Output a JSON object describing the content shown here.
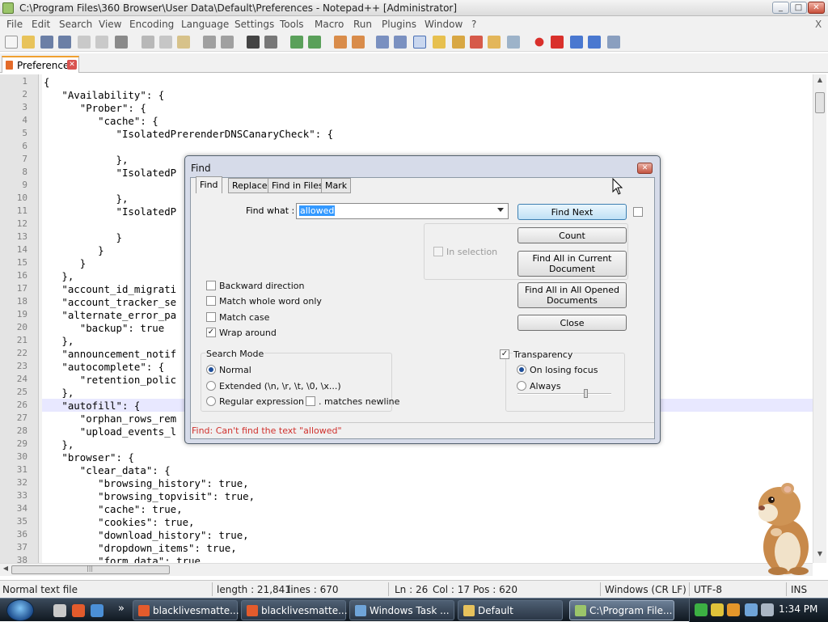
{
  "window": {
    "title": "C:\\Program Files\\360 Browser\\User Data\\Default\\Preferences - Notepad++ [Administrator]",
    "minimize": "_",
    "maximize": "□",
    "close": "✕"
  },
  "menu": {
    "items": [
      "File",
      "Edit",
      "Search",
      "View",
      "Encoding",
      "Language",
      "Settings",
      "Tools",
      "Macro",
      "Run",
      "Plugins",
      "Window",
      "?"
    ],
    "close_x": "X"
  },
  "tab": {
    "label": "Preferences",
    "close": "✕"
  },
  "editor": {
    "line_numbers": [
      "1",
      "2",
      "3",
      "4",
      "5",
      "6",
      "7",
      "8",
      "9",
      "10",
      "11",
      "12",
      "13",
      "14",
      "15",
      "16",
      "17",
      "18",
      "19",
      "20",
      "21",
      "22",
      "23",
      "24",
      "25",
      "26",
      "27",
      "28",
      "29",
      "30",
      "31",
      "32",
      "33",
      "34",
      "35",
      "36",
      "37",
      "38"
    ],
    "lines": [
      "{",
      "   \"Availability\": {",
      "      \"Prober\": {",
      "         \"cache\": {",
      "            \"IsolatedPrerenderDNSCanaryCheck\": {",
      "",
      "            },",
      "            \"IsolatedP",
      "",
      "            },",
      "            \"IsolatedP",
      "",
      "            }",
      "         }",
      "      }",
      "   },",
      "   \"account_id_migrati",
      "   \"account_tracker_se",
      "   \"alternate_error_pa",
      "      \"backup\": true",
      "   },",
      "   \"announcement_notif",
      "   \"autocomplete\": {",
      "      \"retention_polic",
      "   },",
      "   \"autofill\": {",
      "      \"orphan_rows_rem",
      "      \"upload_events_l",
      "   },",
      "   \"browser\": {",
      "      \"clear_data\": {",
      "         \"browsing_history\": true,",
      "         \"browsing_topvisit\": true,",
      "         \"cache\": true,",
      "         \"cookies\": true,",
      "         \"download_history\": true,",
      "         \"dropdown_items\": true,",
      "         \"form_data\": true"
    ]
  },
  "scrollbar": {
    "hthumb_mark": "|||"
  },
  "find_dialog": {
    "title": "Find",
    "close": "✕",
    "tabs": [
      "Find",
      "Replace",
      "Find in Files",
      "Mark"
    ],
    "find_what_label": "Find what :",
    "find_what_value": "allowed",
    "buttons": {
      "find_next": "Find Next",
      "count": "Count",
      "find_all_current": "Find All in Current Document",
      "find_all_opened": "Find All in All Opened Documents",
      "close": "Close"
    },
    "in_selection": "In selection",
    "options": {
      "backward": "Backward direction",
      "whole_word": "Match whole word only",
      "match_case": "Match case",
      "wrap_around": "Wrap around",
      "wrap_checked": "✓"
    },
    "search_mode": {
      "title": "Search Mode",
      "normal": "Normal",
      "extended": "Extended (\\n, \\r, \\t, \\0, \\x...)",
      "regex": "Regular expression",
      "matches_newline": ". matches newline"
    },
    "transparency": {
      "title": "Transparency",
      "checked": "✓",
      "on_losing_focus": "On losing focus",
      "always": "Always"
    },
    "status": "Find: Can't find the text \"allowed\""
  },
  "statusbar": {
    "file_type": "Normal text file",
    "length": "length : 21,841",
    "lines": "lines : 670",
    "ln": "Ln : 26",
    "col": "Col : 17",
    "pos": "Pos : 620",
    "eol": "Windows (CR LF)",
    "encoding": "UTF-8",
    "mode": "INS"
  },
  "taskbar": {
    "tasks": [
      "blacklivesmatte...",
      "blacklivesmatte...",
      "Windows Task ...",
      "Default",
      "C:\\Program File..."
    ],
    "more": "»",
    "clock": "1:34 PM"
  }
}
